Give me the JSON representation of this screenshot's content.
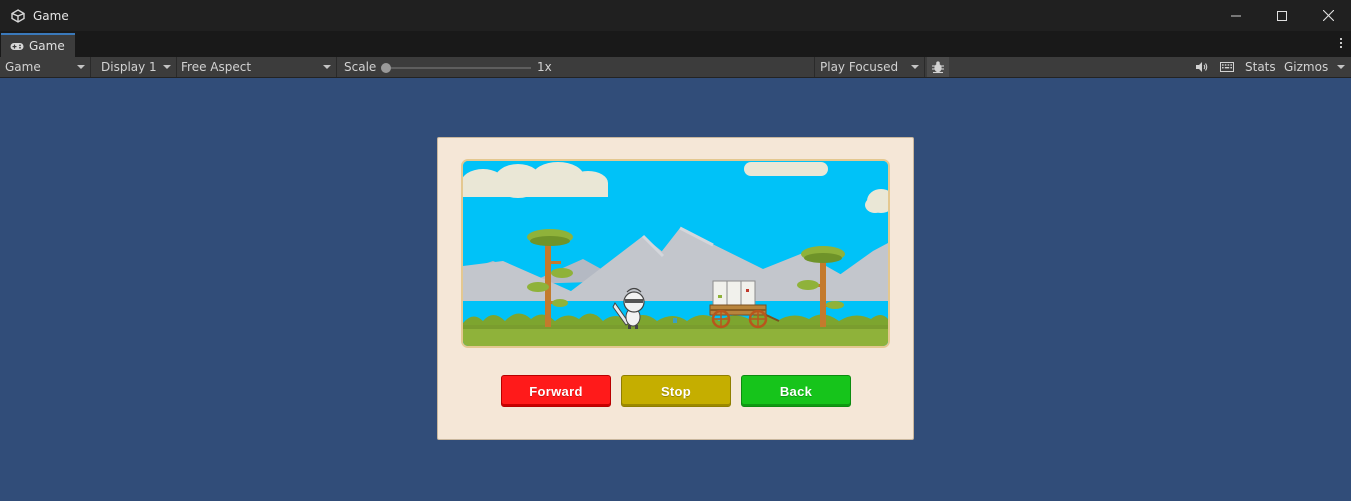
{
  "window": {
    "title": "Game"
  },
  "tab": {
    "label": "Game"
  },
  "toolbar": {
    "view_mode": "Game",
    "display": "Display 1",
    "aspect": "Free Aspect",
    "scale_label": "Scale",
    "scale_value": "1x",
    "play_mode": "Play Focused",
    "stats_label": "Stats",
    "gizmos_label": "Gizmos"
  },
  "game_ui": {
    "forward_label": "Forward",
    "stop_label": "Stop",
    "back_label": "Back"
  },
  "colors": {
    "viewport_bg": "#314d79",
    "panel_bg": "#f5e7d7",
    "forward_button": "#ff1a1a",
    "stop_button": "#c5ae00",
    "back_button": "#16c41b",
    "sky": "#00c2f8",
    "accent_tab": "#3a79bb"
  },
  "icons": {
    "app": "unity-logo-icon",
    "tab": "gamepad-icon",
    "audio": "speaker-icon",
    "keyboard": "keyboard-icon",
    "debug": "bug-icon"
  }
}
